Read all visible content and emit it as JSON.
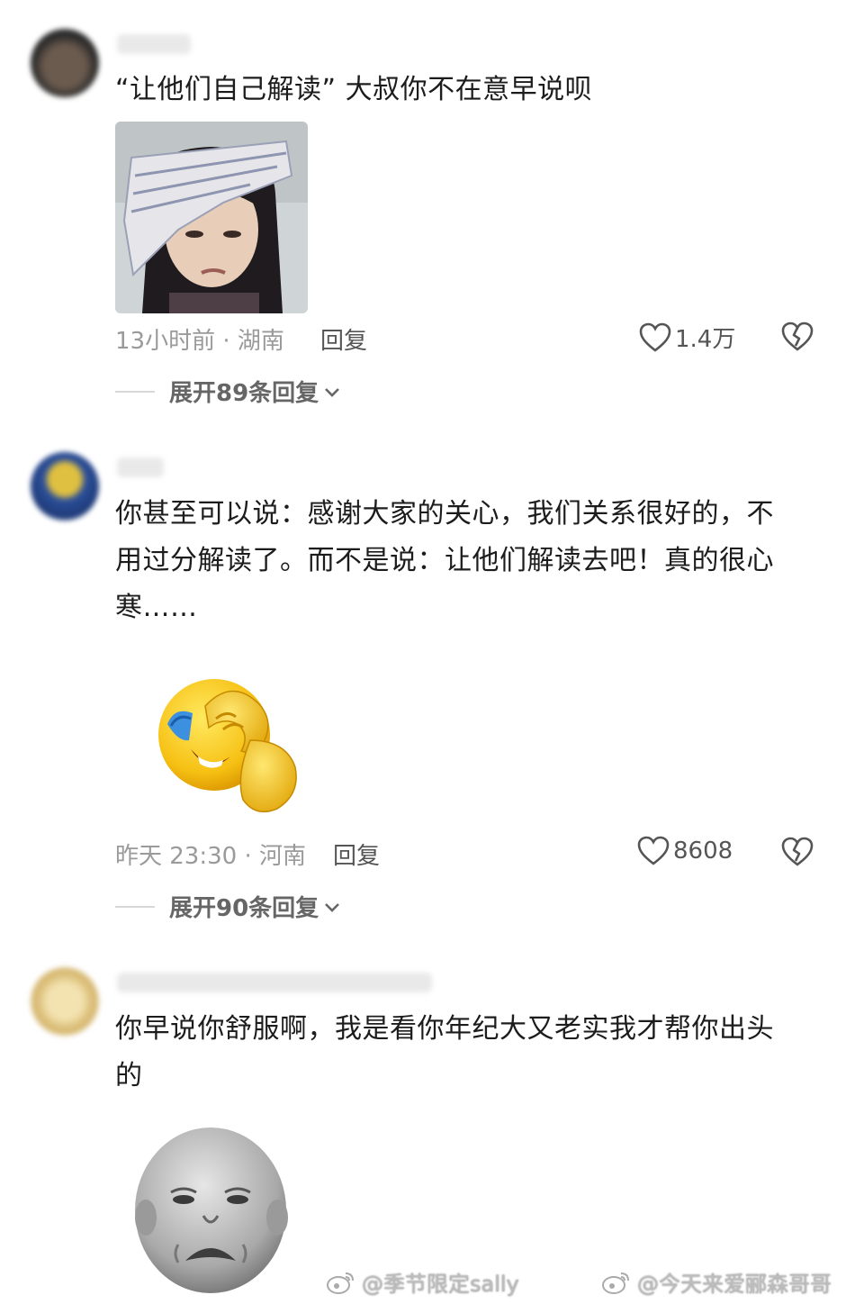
{
  "comments": [
    {
      "text": "“让他们自己解读” 大叔你不在意早说呗",
      "time_location": "13小时前 · 湖南",
      "reply_label": "回复",
      "likes": "1.4万",
      "expand_label": "展开89条回复"
    },
    {
      "text": "你甚至可以说：感谢大家的关心，我们关系很好的，不用过分解读了。而不是说：让他们解读去吧！真的很心寒……",
      "time_location": "昨天 23:30 · 河南",
      "reply_label": "回复",
      "likes": "8608",
      "expand_label": "展开90条回复"
    },
    {
      "text": "你早说你舒服啊，我是看你年纪大又老实我才帮你出头的"
    }
  ],
  "watermarks": [
    "@季节限定sally",
    "@今天来爱郦森哥哥"
  ],
  "icons": {
    "like": "heart-outline-icon",
    "dislike": "broken-heart-icon",
    "expand": "chevron-down-icon",
    "watermark": "weibo-logo-icon"
  }
}
